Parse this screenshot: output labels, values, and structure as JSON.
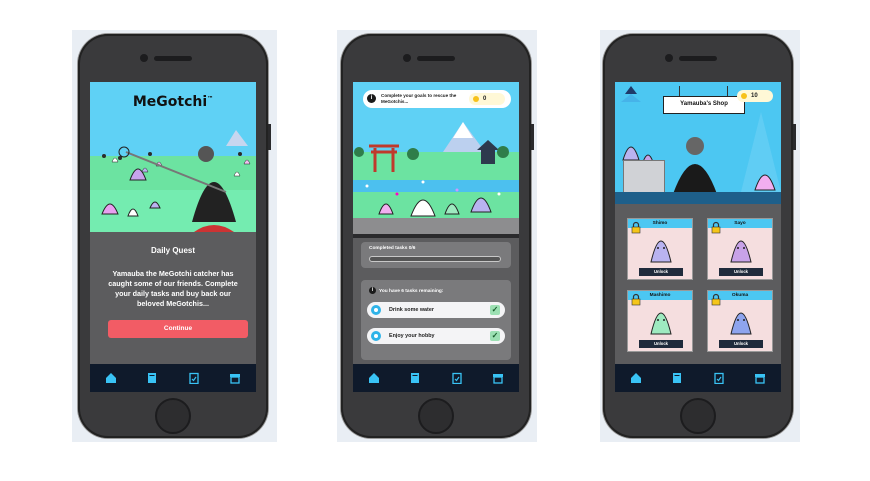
{
  "screen1": {
    "brand": "MeGotchi",
    "trademark": "™",
    "heading": "Daily Quest",
    "text": "Yamauba the MeGotchi catcher has caught some of our friends. Complete your daily tasks and buy back our beloved MeGotchis...",
    "continue_label": "Continue"
  },
  "screen2": {
    "banner": "Complete your goals to rescue the MeGotchis...",
    "coins": "0",
    "completed_label": "Completed tasks 0/6",
    "remaining_label": "You have 6 tasks remaining:",
    "tasks": [
      {
        "label": "Drink some water"
      },
      {
        "label": "Enjoy your hobby"
      }
    ]
  },
  "screen3": {
    "shop_title": "Yamauba's Shop",
    "coins": "10",
    "items": [
      {
        "name": "Shimo",
        "button": "Unlock",
        "color": "#b9b3f0"
      },
      {
        "name": "Sayo",
        "button": "Unlock",
        "color": "#c8a2e8"
      },
      {
        "name": "Mashimo",
        "button": "Unlock",
        "color": "#9eeac0"
      },
      {
        "name": "Okuma",
        "button": "Unlock",
        "color": "#8ea4ee"
      }
    ]
  },
  "nav": [
    "home-icon",
    "book-icon",
    "clipboard-icon",
    "shop-icon"
  ],
  "colors": {
    "sky": "#5fd1f5",
    "grass": "#6ce3a1",
    "accent_button": "#f25c65",
    "navbar": "#0f1a2b",
    "nav_icon": "#39c3f5"
  }
}
